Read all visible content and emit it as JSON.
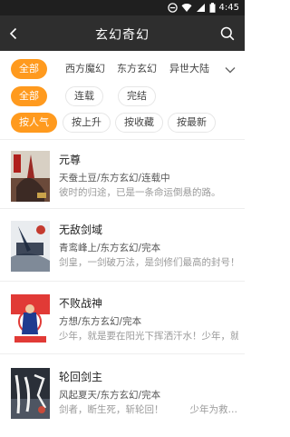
{
  "status_bar": {
    "time": "4:45"
  },
  "app_bar": {
    "title": "玄幻奇幻"
  },
  "filters": {
    "category": [
      "全部",
      "西方魔幻",
      "东方玄幻",
      "异世大陆"
    ],
    "status": [
      "全部",
      "连载",
      "完结"
    ],
    "sort": [
      "按人气",
      "按上升",
      "按收藏",
      "按最新"
    ]
  },
  "books": [
    {
      "title": "元尊",
      "meta": "天蚕土豆/东方玄幻/连载中",
      "desc": "彼时的归途，已是一条命运倒悬的路。",
      "desc_right": ""
    },
    {
      "title": "无敌剑域",
      "meta": "青鸾峰上/东方玄幻/完本",
      "desc": "剑皇，一剑破万法，是剑修们最高的封号！",
      "desc_right": ""
    },
    {
      "title": "不败战神",
      "meta": "方想/东方玄幻/完本",
      "desc": "少年，就是要在阳光下挥洒汗水！少年，就是要",
      "desc_right": ""
    },
    {
      "title": "轮回剑主",
      "meta": "风起夏天/东方玄幻/完本",
      "desc": "剑者，断生死，斩轮回！",
      "desc_right": "少年为救…"
    }
  ],
  "colors": {
    "accent": "#ff9a1e",
    "appbar": "#2e2e2e",
    "statusbar": "#1f1f1f"
  }
}
